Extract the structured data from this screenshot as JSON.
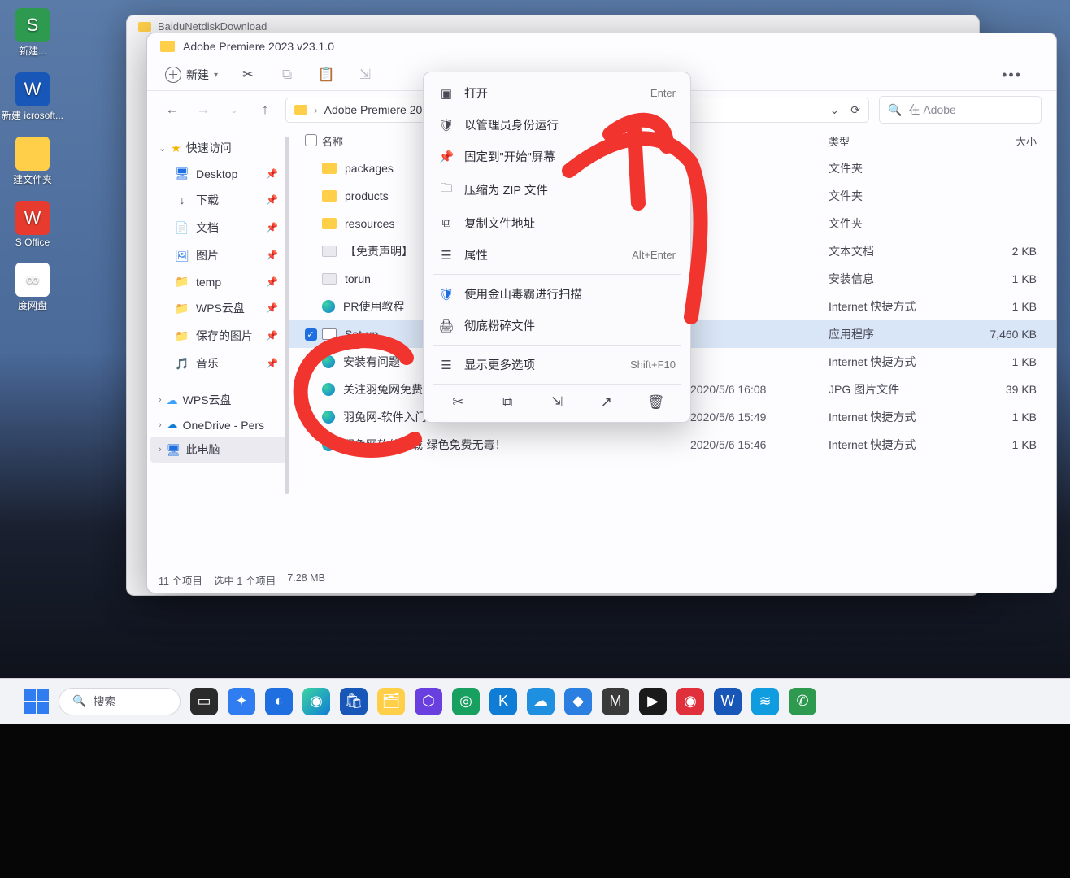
{
  "desktop_icons": [
    {
      "label": "新建...",
      "color": "#2e9a4f",
      "glyph": "S"
    },
    {
      "label": "新建 icrosoft...",
      "color": "#1857b8",
      "glyph": "W"
    },
    {
      "label": "建文件夹",
      "color": "#ffcf4a",
      "glyph": ""
    },
    {
      "label": "S Office",
      "color": "#e63b2e",
      "glyph": "W"
    },
    {
      "label": "度网盘",
      "color": "#ffffff",
      "glyph": "∞"
    }
  ],
  "parent_window_title": "BaiduNetdiskDownload",
  "window_title": "Adobe Premiere 2023 v23.1.0",
  "toolbar": {
    "new_label": "新建"
  },
  "breadcrumb": {
    "text": "Adobe Premiere 20"
  },
  "search_placeholder": "在 Adobe",
  "sidebar": {
    "quick_access": "快速访问",
    "items": [
      {
        "glyph": "🖥",
        "label": "Desktop",
        "color": "#1f6fe0"
      },
      {
        "glyph": "↓",
        "label": "下载",
        "color": "#4a4a56"
      },
      {
        "glyph": "📄",
        "label": "文档",
        "color": "#1f6fe0"
      },
      {
        "glyph": "🖼",
        "label": "图片",
        "color": "#1f6fe0"
      },
      {
        "glyph": "📁",
        "label": "temp",
        "color": "#ffcf4a"
      },
      {
        "glyph": "📁",
        "label": "WPS云盘",
        "color": "#ffcf4a"
      },
      {
        "glyph": "📁",
        "label": "保存的图片",
        "color": "#ffcf4a"
      },
      {
        "glyph": "🎵",
        "label": "音乐",
        "color": "#ff5c3e"
      }
    ],
    "wps": "WPS云盘",
    "onedrive": "OneDrive - Pers",
    "this_pc": "此电脑"
  },
  "columns": {
    "name": "名称",
    "date": "",
    "type": "类型",
    "size": "大小"
  },
  "files": [
    {
      "name": "packages",
      "date": "",
      "type": "文件夹",
      "size": "",
      "icon": "folder"
    },
    {
      "name": "products",
      "date": "",
      "type": "文件夹",
      "size": "",
      "icon": "folder"
    },
    {
      "name": "resources",
      "date": "",
      "type": "文件夹",
      "size": "",
      "icon": "folder"
    },
    {
      "name": "【免责声明】",
      "date": "",
      "type": "文本文档",
      "size": "2 KB",
      "icon": "txt"
    },
    {
      "name": "torun",
      "date": "",
      "type": "安装信息",
      "size": "1 KB",
      "icon": "txt"
    },
    {
      "name": "PR使用教程",
      "date": "",
      "type": "Internet 快捷方式",
      "size": "1 KB",
      "icon": "edge"
    },
    {
      "name": "Set-up",
      "date": "",
      "type": "应用程序",
      "size": "7,460 KB",
      "icon": "app",
      "selected": true
    },
    {
      "name": "安装有问题---",
      "date": "",
      "type": "Internet 快捷方式",
      "size": "1 KB",
      "icon": "edge"
    },
    {
      "name": "关注羽兔网免费送会员",
      "date": "2020/5/6 16:08",
      "type": "JPG 图片文件",
      "size": "39 KB",
      "icon": "edge"
    },
    {
      "name": "羽兔网-软件入门免费学!",
      "date": "2020/5/6 15:49",
      "type": "Internet 快捷方式",
      "size": "1 KB",
      "icon": "edge"
    },
    {
      "name": "羽兔网软件下载-绿色免费无毒！",
      "date": "2020/5/6 15:46",
      "type": "Internet 快捷方式",
      "size": "1 KB",
      "icon": "edge"
    }
  ],
  "status": {
    "count": "11 个项目",
    "selection": "选中 1 个项目",
    "size": "7.28 MB"
  },
  "context_menu": [
    {
      "icon": "▣",
      "label": "打开",
      "shortcut": "Enter"
    },
    {
      "icon": "🛡",
      "label": "以管理员身份运行",
      "shortcut": ""
    },
    {
      "icon": "📌",
      "label": "固定到\"开始\"屏幕",
      "shortcut": ""
    },
    {
      "icon": "🗀",
      "label": "压缩为 ZIP 文件",
      "shortcut": ""
    },
    {
      "icon": "⧉",
      "label": "复制文件地址",
      "shortcut": ""
    },
    {
      "icon": "☰",
      "label": "属性",
      "shortcut": "Alt+Enter"
    },
    {
      "sep": true
    },
    {
      "icon": "🛡",
      "label": "使用金山毒霸进行扫描",
      "shortcut": "",
      "blue": true
    },
    {
      "icon": "🖨",
      "label": "彻底粉碎文件",
      "shortcut": ""
    },
    {
      "sep": true
    },
    {
      "icon": "☰",
      "label": "显示更多选项",
      "shortcut": "Shift+F10"
    }
  ],
  "ctx_action_icons": [
    "✂",
    "⧉",
    "⇲",
    "↗",
    "🗑"
  ],
  "taskbar_search": "搜索"
}
